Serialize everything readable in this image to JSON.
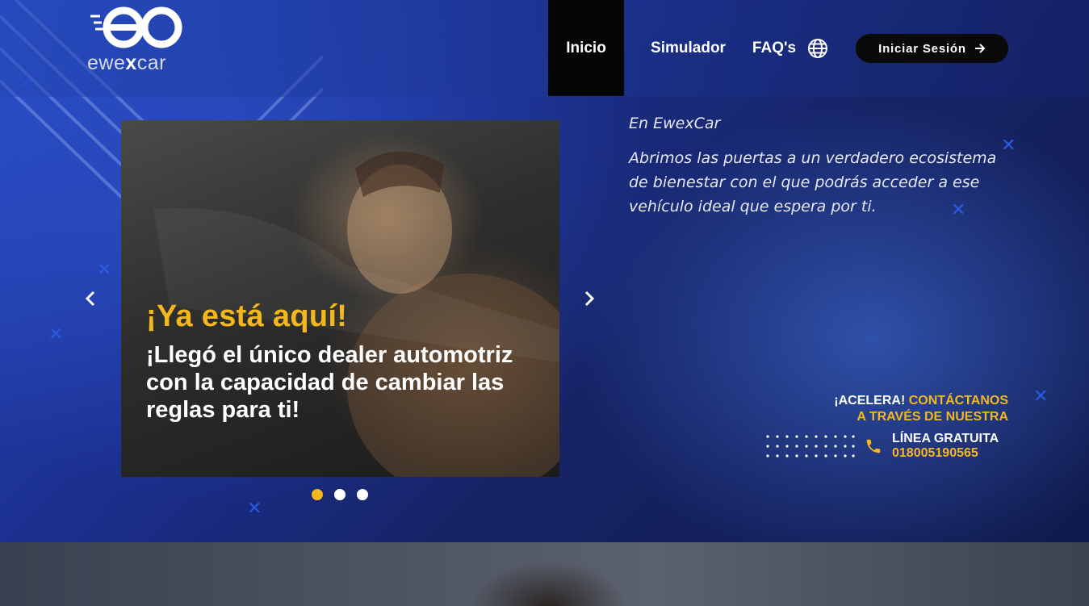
{
  "brand": {
    "logo_prefix": "ewe",
    "logo_x": "x",
    "logo_suffix": "car",
    "logo_icon": "eo-monogram-icon"
  },
  "nav": {
    "items": [
      {
        "label": "Inicio",
        "active": true
      },
      {
        "label": "Simulador",
        "active": false
      },
      {
        "label": "FAQ's",
        "active": false
      }
    ],
    "language_icon": "globe-icon",
    "login_label": "Iniciar Sesión",
    "login_icon": "arrow-right-icon"
  },
  "carousel": {
    "headline": "¡Ya está aquí!",
    "body": "¡Llegó el único dealer automotriz con la capacidad de cambiar las reglas para ti!",
    "prev_icon": "chevron-left-icon",
    "next_icon": "chevron-right-icon",
    "slide_count": 3,
    "active_index": 0
  },
  "intro": {
    "title": "En EwexCar",
    "body": "Abrimos las puertas a un verdadero ecosistema de bienestar con el que podrás acceder a ese vehículo ideal que espera por ti."
  },
  "contact": {
    "cta_white": "¡ACELERA!",
    "cta_yellow_1": "CONTÁCTANOS",
    "cta_yellow_2": "A TRAVÉS DE NUESTRA",
    "line_label": "LÍNEA GRATUITA",
    "phone": "018005190565",
    "phone_icon": "phone-icon"
  },
  "colors": {
    "accent": "#f5b71e",
    "nav_active_bg": "#050505",
    "button_bg": "#0a0a0a",
    "hero_blue": "#1b2f8e"
  }
}
